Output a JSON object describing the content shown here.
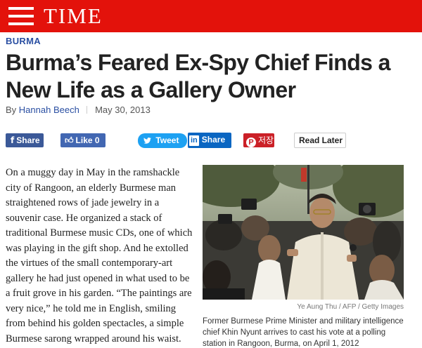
{
  "header": {
    "brand": "TIME"
  },
  "article": {
    "section": "BURMA",
    "headline": "Burma’s Feared Ex-Spy Chief Finds a New Life as a Gallery Owner",
    "byline_prefix": "By",
    "author": "Hannah Beech",
    "date": "May 30, 2013",
    "body": "On a muggy day in May in the ramshackle city of Rangoon, an elderly Burmese man straightened rows of jade jewelry in a souvenir case. He organized a stack of traditional Burmese music CDs, one of which was playing in the gift shop. And he extolled the virtues of the small contemporary-art gallery he had just opened in what used to be a fruit grove in his garden. “The paintings are very nice,” he told me in English, smiling from behind his golden spectacles, a simple Burmese sarong wrapped around his waist. “You are"
  },
  "sharebar": {
    "fb_share": "Share",
    "fb_like": "Like 0",
    "tweet": "Tweet",
    "linkedin_badge": "in",
    "linkedin": "Share",
    "pinterest": "저장",
    "read_later": "Read Later"
  },
  "photo": {
    "credit": "Ye Aung Thu / AFP / Getty Images",
    "caption": "Former Burmese Prime Minister and military intelligence chief Khin Nyunt arrives to cast his vote at a polling station in Rangoon, Burma, on April 1, 2012"
  },
  "colors": {
    "brand_red": "#e3120b",
    "link_blue": "#2a4fa2",
    "facebook": "#3b5998",
    "twitter": "#1da1f2",
    "linkedin": "#0a66c2",
    "pinterest": "#cb2027"
  }
}
